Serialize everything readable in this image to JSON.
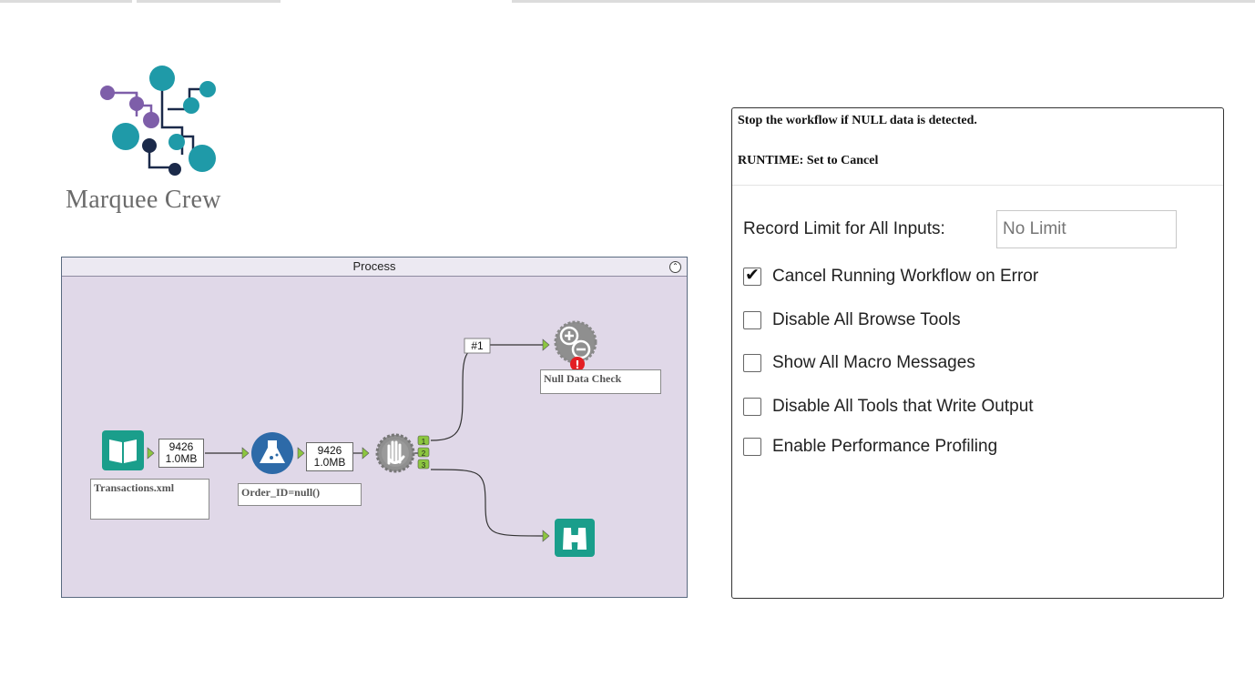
{
  "logo": {
    "name": "Marquee Crew",
    "colors": {
      "teal": "#1f9aa8",
      "purple": "#7e5ea9",
      "navy": "#1b2a4a"
    }
  },
  "process": {
    "title": "Process",
    "tools": {
      "input": {
        "label": "Transactions.xml",
        "icon": "book-icon",
        "color": "#1a9e8b"
      },
      "formula": {
        "label": "Order_ID=null()",
        "icon": "flask-icon",
        "color": "#2d6aa8"
      },
      "filter": {
        "icon": "hand-icon"
      },
      "message": {
        "label": "Null Data Check",
        "icon": "plus-minus-gear-icon",
        "error_icon": "error-icon"
      },
      "browse": {
        "icon": "binoculars-icon",
        "color": "#1a9e8b"
      }
    },
    "counts": [
      {
        "records": "9426",
        "size": "1.0MB"
      },
      {
        "records": "9426",
        "size": "1.0MB"
      }
    ],
    "connection_label": "#1",
    "anchors": [
      "1",
      "2",
      "3"
    ]
  },
  "config": {
    "annotation": "Stop the workflow if NULL data is detected.",
    "runtime_note": "RUNTIME:  Set to Cancel",
    "record_limit_label": "Record Limit for All Inputs:",
    "record_limit_placeholder": "No Limit",
    "options": [
      {
        "label": "Cancel Running Workflow on Error",
        "checked": true
      },
      {
        "label": "Disable All Browse Tools",
        "checked": false
      },
      {
        "label": "Show All Macro Messages",
        "checked": false
      },
      {
        "label": "Disable All Tools that Write Output",
        "checked": false
      },
      {
        "label": "Enable Performance Profiling",
        "checked": false
      }
    ]
  }
}
